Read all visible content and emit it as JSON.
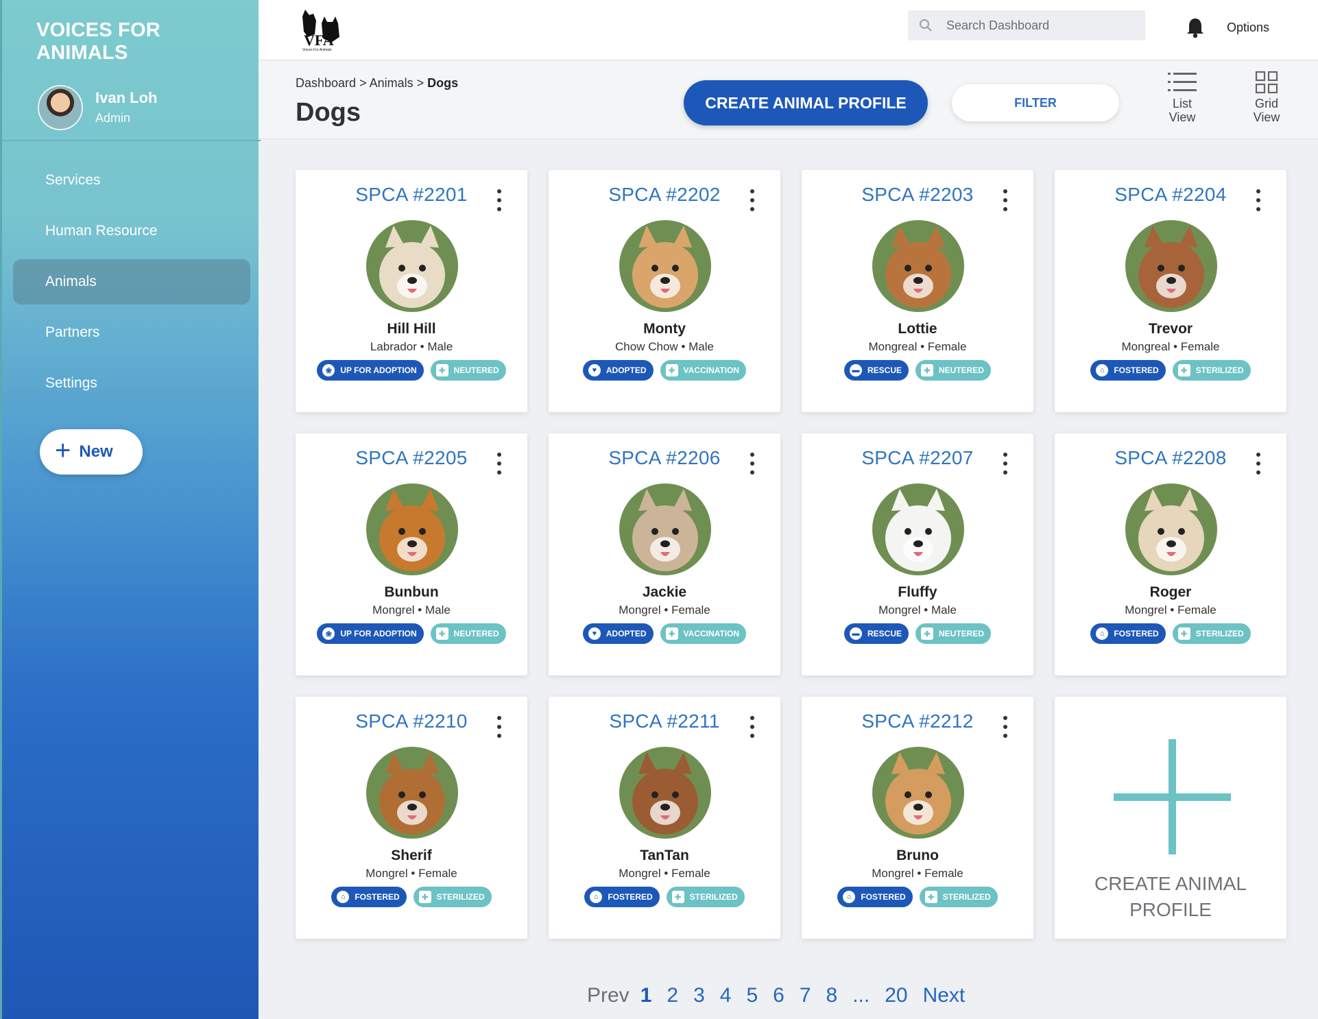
{
  "sidebar": {
    "brand": "VOICES FOR ANIMALS",
    "user": {
      "name": "Ivan Loh",
      "role": "Admin"
    },
    "items": [
      {
        "label": "Services",
        "active": false
      },
      {
        "label": "Human Resource",
        "active": false
      },
      {
        "label": "Animals",
        "active": true
      },
      {
        "label": "Partners",
        "active": false
      },
      {
        "label": "Settings",
        "active": false
      }
    ],
    "new_label": "New"
  },
  "topbar": {
    "search_placeholder": "Search Dashboard",
    "options_label": "Options",
    "logo_text": "VFA",
    "logo_caption": "Voices For Animals"
  },
  "header": {
    "breadcrumb": [
      "Dashboard",
      "Animals",
      "Dogs"
    ],
    "title": "Dogs",
    "create_label": "CREATE ANIMAL PROFILE",
    "filter_label": "FILTER",
    "list_view_label": [
      "List",
      "View"
    ],
    "grid_view_label": [
      "Grid",
      "View"
    ]
  },
  "animals": [
    {
      "id": "SPCA #2201",
      "name": "Hill Hill",
      "breed": "Labrador",
      "sex": "Male",
      "status": "UP FOR ADOPTION",
      "status_icon": "paw-icon",
      "health": "NEUTERED",
      "color": "#e8dcc6"
    },
    {
      "id": "SPCA #2202",
      "name": "Monty",
      "breed": "Chow Chow",
      "sex": "Male",
      "status": "ADOPTED",
      "status_icon": "heart-icon",
      "health": "VACCINATION",
      "color": "#d9a56b"
    },
    {
      "id": "SPCA #2203",
      "name": "Lottie",
      "breed": "Mongreal",
      "sex": "Female",
      "status": "RESCUE",
      "status_icon": "van-icon",
      "health": "NEUTERED",
      "color": "#b8743c"
    },
    {
      "id": "SPCA #2204",
      "name": "Trevor",
      "breed": "Mongreal",
      "sex": "Female",
      "status": "FOSTERED",
      "status_icon": "home-icon",
      "health": "STERILIZED",
      "color": "#a7643a"
    },
    {
      "id": "SPCA #2205",
      "name": "Bunbun",
      "breed": "Mongrel",
      "sex": "Male",
      "status": "UP FOR ADOPTION",
      "status_icon": "paw-icon",
      "health": "NEUTERED",
      "color": "#c7792e"
    },
    {
      "id": "SPCA #2206",
      "name": "Jackie",
      "breed": "Mongrel",
      "sex": "Female",
      "status": "ADOPTED",
      "status_icon": "heart-icon",
      "health": "VACCINATION",
      "color": "#cbb497"
    },
    {
      "id": "SPCA #2207",
      "name": "Fluffy",
      "breed": "Mongrel",
      "sex": "Male",
      "status": "RESCUE",
      "status_icon": "van-icon",
      "health": "NEUTERED",
      "color": "#f4f4f2"
    },
    {
      "id": "SPCA #2208",
      "name": "Roger",
      "breed": "Mongrel",
      "sex": "Female",
      "status": "FOSTERED",
      "status_icon": "home-icon",
      "health": "STERILIZED",
      "color": "#e5d6bc"
    },
    {
      "id": "SPCA #2210",
      "name": "Sherif",
      "breed": "Mongrel",
      "sex": "Female",
      "status": "FOSTERED",
      "status_icon": "home-icon",
      "health": "STERILIZED",
      "color": "#b06e34"
    },
    {
      "id": "SPCA #2211",
      "name": "TanTan",
      "breed": "Mongrel",
      "sex": "Female",
      "status": "FOSTERED",
      "status_icon": "home-icon",
      "health": "STERILIZED",
      "color": "#9c5c33"
    },
    {
      "id": "SPCA #2212",
      "name": "Bruno",
      "breed": "Mongrel",
      "sex": "Female",
      "status": "FOSTERED",
      "status_icon": "home-icon",
      "health": "STERILIZED",
      "color": "#d49c5e"
    }
  ],
  "create_card_label": "CREATE ANIMAL PROFILE",
  "pagination": {
    "prev": "Prev",
    "pages": [
      "1",
      "2",
      "3",
      "4",
      "5",
      "6",
      "7",
      "8",
      "...",
      "20"
    ],
    "current": "1",
    "next": "Next"
  },
  "colors": {
    "accent": "#1d58b8",
    "teal": "#6cc2c4",
    "id_blue": "#2f74c2"
  }
}
